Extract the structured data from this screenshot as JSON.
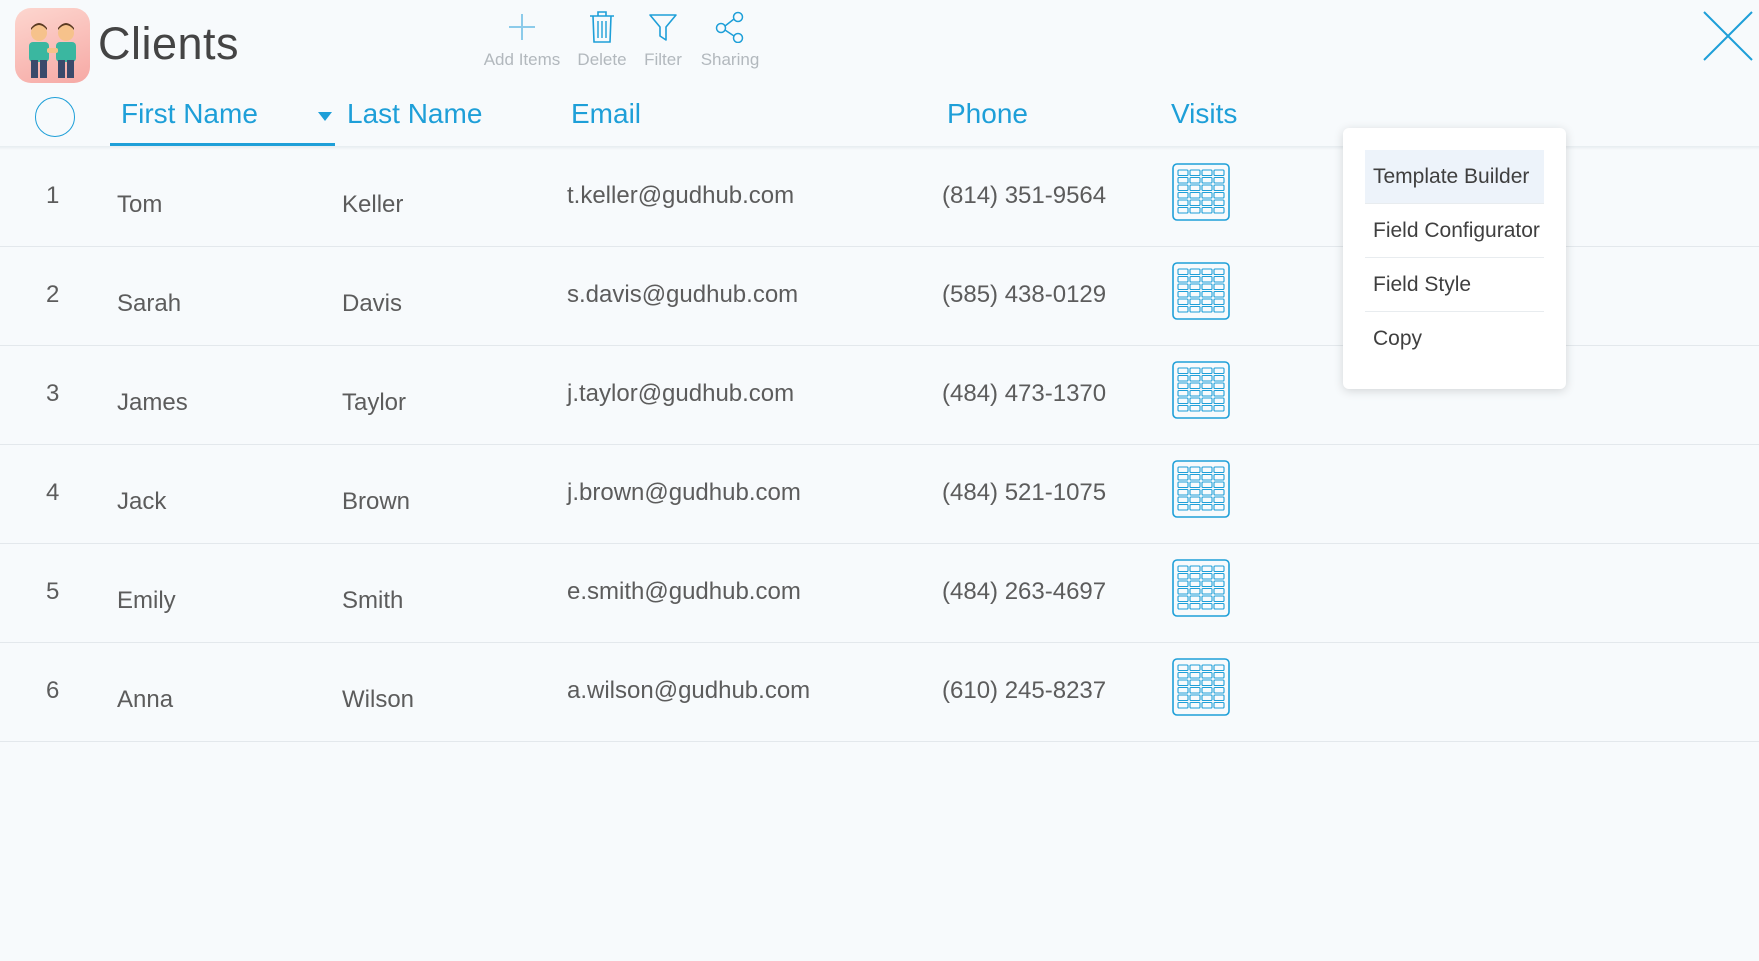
{
  "app": {
    "title": "Clients",
    "icon": "two-people-icon"
  },
  "toolbar": {
    "add_label": "Add Items",
    "delete_label": "Delete",
    "filter_label": "Filter",
    "sharing_label": "Sharing"
  },
  "columns": {
    "first_name": "First Name",
    "last_name": "Last Name",
    "email": "Email",
    "phone": "Phone",
    "visits": "Visits",
    "sorted_by": "First Name"
  },
  "rows": [
    {
      "num": "1",
      "first": "Tom",
      "last": "Keller",
      "email": "t.keller@gudhub.com",
      "phone": "(814) 351-9564"
    },
    {
      "num": "2",
      "first": "Sarah",
      "last": "Davis",
      "email": "s.davis@gudhub.com",
      "phone": "(585) 438-0129"
    },
    {
      "num": "3",
      "first": "James",
      "last": "Taylor",
      "email": "j.taylor@gudhub.com",
      "phone": "(484) 473-1370"
    },
    {
      "num": "4",
      "first": "Jack",
      "last": "Brown",
      "email": "j.brown@gudhub.com",
      "phone": "(484) 521-1075"
    },
    {
      "num": "5",
      "first": "Emily",
      "last": "Smith",
      "email": "e.smith@gudhub.com",
      "phone": "(484) 263-4697"
    },
    {
      "num": "6",
      "first": "Anna",
      "last": "Wilson",
      "email": "a.wilson@gudhub.com",
      "phone": "(610) 245-8237"
    }
  ],
  "context_menu": {
    "items": [
      "Template Builder",
      "Field Configurator",
      "Field Style",
      "Copy"
    ],
    "highlighted": "Template Builder"
  },
  "colors": {
    "accent": "#1e9fd8",
    "toolbar_label": "#b2b8bd",
    "background": "#f7fafc"
  }
}
